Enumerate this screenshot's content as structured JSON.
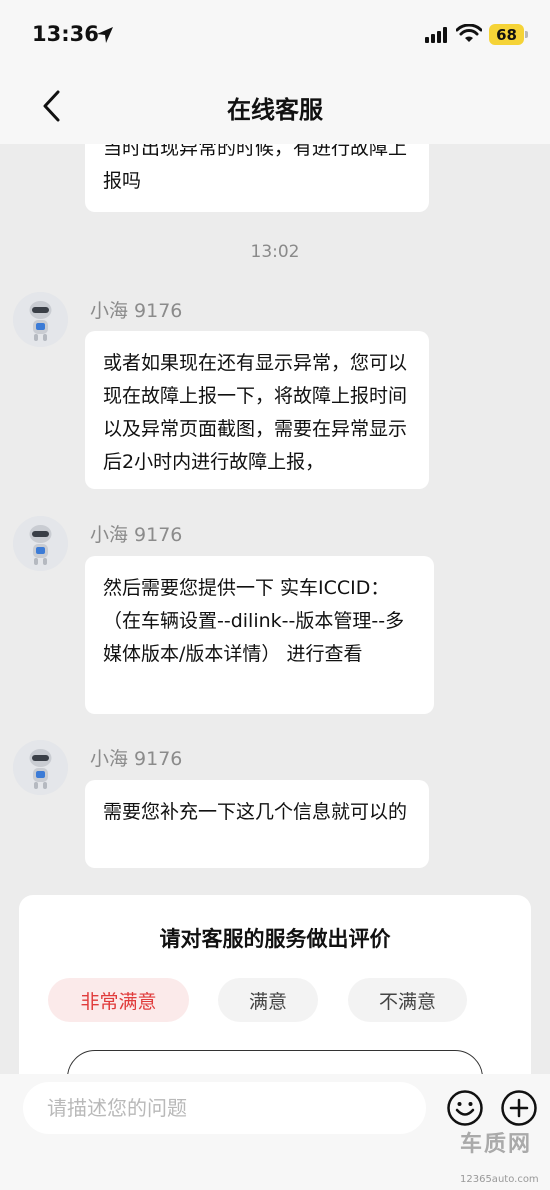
{
  "status": {
    "time": "13:36",
    "battery": "68"
  },
  "nav": {
    "title": "在线客服"
  },
  "chat": {
    "prev_message": "当时出现异常的时候，有进行故障上报吗",
    "timestamp": "13:02",
    "messages": [
      {
        "sender": "小海 9176",
        "text": "或者如果现在还有显示异常，您可以现在故障上报一下，将故障上报时间以及异常页面截图，需要在异常显示后2小时内进行故障上报，"
      },
      {
        "sender": "小海 9176",
        "text": "然后需要您提供一下  实车ICCID：（在车辆设置--dilink--版本管理--多媒体版本/版本详情） 进行查看"
      },
      {
        "sender": "小海 9176",
        "text": "需要您补充一下这几个信息就可以的"
      }
    ]
  },
  "rating": {
    "title": "请对客服的服务做出评价",
    "options": [
      "非常满意",
      "满意",
      "不满意"
    ]
  },
  "input": {
    "placeholder": "请描述您的问题"
  },
  "watermark": {
    "logo": "车质网",
    "url": "12365auto.com"
  }
}
